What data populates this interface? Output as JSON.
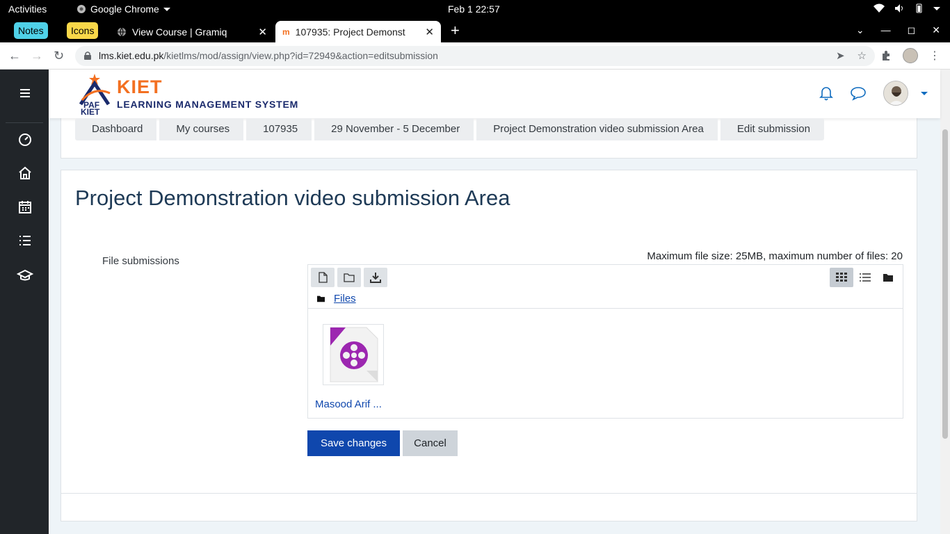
{
  "system_bar": {
    "activities": "Activities",
    "app_name": "Google Chrome",
    "clock": "Feb 1  22:57"
  },
  "tabs": {
    "group_notes": "Notes",
    "group_icons": "Icons",
    "items": [
      {
        "title": "View Course | Gramiq",
        "active": false
      },
      {
        "title": "107935: Project Demonst",
        "active": true
      }
    ],
    "new_tab": "+"
  },
  "address_bar": {
    "host": "lms.kiet.edu.pk",
    "path": "/kietlms/mod/assign/view.php?id=72949&action=editsubmission"
  },
  "site": {
    "logo_kiet": "KIET",
    "logo_sub": "LEARNING MANAGEMENT SYSTEM",
    "logo_badge_top": "PAF",
    "logo_badge_bottom": "KIET"
  },
  "breadcrumb": [
    "Dashboard",
    "My courses",
    "107935",
    "29 November - 5 December",
    "Project Demonstration video submission Area",
    "Edit submission"
  ],
  "main": {
    "title": "Project Demonstration video submission Area",
    "field_label": "File submissions",
    "limits": "Maximum file size: 25MB, maximum number of files: 20",
    "path_label": "Files",
    "file_name": "Masood Arif ...",
    "save_label": "Save changes",
    "cancel_label": "Cancel"
  },
  "colors": {
    "primary": "#0f47ad",
    "kiet_orange": "#f37021",
    "drawer": "#212529",
    "title": "#1e3a56",
    "file_icon_purple": "#9c27b0"
  }
}
